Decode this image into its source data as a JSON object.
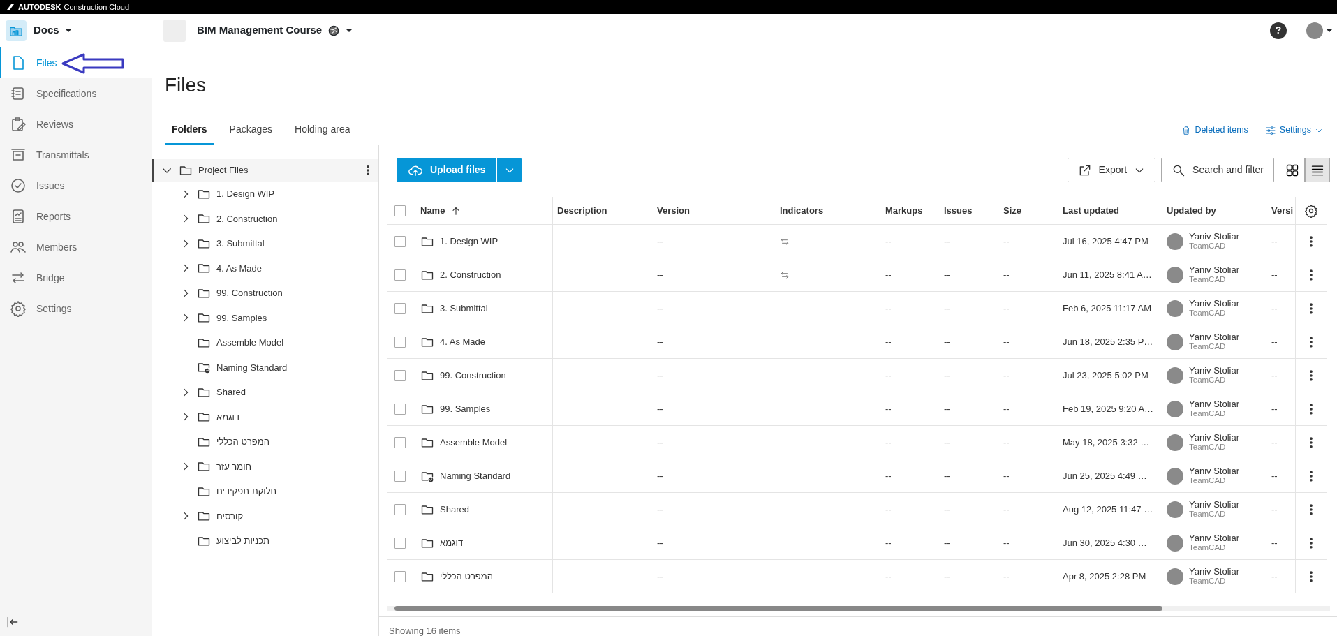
{
  "brand": {
    "name": "AUTODESK",
    "product": "Construction Cloud"
  },
  "header": {
    "module": "Docs",
    "project": "BIM Management Course",
    "help": "?"
  },
  "sidebar": {
    "items": [
      {
        "label": "Files",
        "selected": true
      },
      {
        "label": "Specifications",
        "selected": false
      },
      {
        "label": "Reviews",
        "selected": false
      },
      {
        "label": "Transmittals",
        "selected": false
      },
      {
        "label": "Issues",
        "selected": false
      },
      {
        "label": "Reports",
        "selected": false
      },
      {
        "label": "Members",
        "selected": false
      },
      {
        "label": "Bridge",
        "selected": false
      },
      {
        "label": "Settings",
        "selected": false
      }
    ]
  },
  "page": {
    "title": "Files"
  },
  "tabs": [
    {
      "label": "Folders",
      "selected": true
    },
    {
      "label": "Packages",
      "selected": false
    },
    {
      "label": "Holding area",
      "selected": false
    }
  ],
  "links": {
    "deleted": "Deleted items",
    "settings": "Settings"
  },
  "tree": {
    "label": "Project Files",
    "expanded": true,
    "selected": true,
    "children": [
      {
        "label": "1. Design WIP",
        "kind": "folder",
        "expandable": true
      },
      {
        "label": "2. Construction",
        "kind": "folder",
        "expandable": true
      },
      {
        "label": "3. Submittal",
        "kind": "folder",
        "expandable": true
      },
      {
        "label": "4. As Made",
        "kind": "folder",
        "expandable": true
      },
      {
        "label": "99. Construction",
        "kind": "folder",
        "expandable": true
      },
      {
        "label": "99. Samples",
        "kind": "folder",
        "expandable": true
      },
      {
        "label": "Assemble Model",
        "kind": "folder",
        "expandable": false
      },
      {
        "label": "Naming Standard",
        "kind": "standard",
        "expandable": false
      },
      {
        "label": "Shared",
        "kind": "folder",
        "expandable": true
      },
      {
        "label": "דוגמא",
        "kind": "folder",
        "expandable": true
      },
      {
        "label": "המפרט הכללי",
        "kind": "folder",
        "expandable": false
      },
      {
        "label": "חומר עזר",
        "kind": "folder",
        "expandable": true
      },
      {
        "label": "חלוקת תפקידים",
        "kind": "folder",
        "expandable": false
      },
      {
        "label": "קורסים",
        "kind": "folder",
        "expandable": true
      },
      {
        "label": "תכניות לביצוע",
        "kind": "folder",
        "expandable": false
      }
    ]
  },
  "toolbar": {
    "upload": "Upload files",
    "export": "Export",
    "search": "Search and filter",
    "views": [
      {
        "kind": "grid",
        "selected": false
      },
      {
        "kind": "list",
        "selected": true
      }
    ]
  },
  "table": {
    "all_checked": false,
    "columns": [
      {
        "label": "Name",
        "sorted": true
      },
      {
        "label": "Description",
        "sorted": false
      },
      {
        "label": "Version",
        "sorted": false
      },
      {
        "label": "Indicators",
        "sorted": false
      },
      {
        "label": "Markups",
        "sorted": false
      },
      {
        "label": "Issues",
        "sorted": false
      },
      {
        "label": "Size",
        "sorted": false
      },
      {
        "label": "Last updated",
        "sorted": false
      },
      {
        "label": "Updated by",
        "sorted": false
      },
      {
        "label": "Versi",
        "sorted": false
      }
    ],
    "rows": [
      {
        "name": "1. Design WIP",
        "kind": "folder",
        "checked": false,
        "version": "--",
        "synced": true,
        "markups": "--",
        "issues": "--",
        "size": "--",
        "last_updated": "Jul 16, 2025 4:47 PM",
        "user": "Yaniv Stoliar",
        "company": "TeamCAD",
        "column_10": "--"
      },
      {
        "name": "2. Construction",
        "kind": "folder",
        "checked": false,
        "version": "--",
        "synced": true,
        "markups": "--",
        "issues": "--",
        "size": "--",
        "last_updated": "Jun 11, 2025 8:41 A…",
        "user": "Yaniv Stoliar",
        "company": "TeamCAD",
        "column_10": "--"
      },
      {
        "name": "3. Submittal",
        "kind": "folder",
        "checked": false,
        "version": "--",
        "synced": false,
        "markups": "--",
        "issues": "--",
        "size": "--",
        "last_updated": "Feb 6, 2025 11:17 AM",
        "user": "Yaniv Stoliar",
        "company": "TeamCAD",
        "column_10": "--"
      },
      {
        "name": "4. As Made",
        "kind": "folder",
        "checked": false,
        "version": "--",
        "synced": false,
        "markups": "--",
        "issues": "--",
        "size": "--",
        "last_updated": "Jun 18, 2025 2:35 P…",
        "user": "Yaniv Stoliar",
        "company": "TeamCAD",
        "column_10": "--"
      },
      {
        "name": "99. Construction",
        "kind": "folder",
        "checked": false,
        "version": "--",
        "synced": false,
        "markups": "--",
        "issues": "--",
        "size": "--",
        "last_updated": "Jul 23, 2025 5:02 PM",
        "user": "Yaniv Stoliar",
        "company": "TeamCAD",
        "column_10": "--"
      },
      {
        "name": "99. Samples",
        "kind": "folder",
        "checked": false,
        "version": "--",
        "synced": false,
        "markups": "--",
        "issues": "--",
        "size": "--",
        "last_updated": "Feb 19, 2025 9:20 A…",
        "user": "Yaniv Stoliar",
        "company": "TeamCAD",
        "column_10": "--"
      },
      {
        "name": "Assemble Model",
        "kind": "folder",
        "checked": false,
        "version": "--",
        "synced": false,
        "markups": "--",
        "issues": "--",
        "size": "--",
        "last_updated": "May 18, 2025 3:32 …",
        "user": "Yaniv Stoliar",
        "company": "TeamCAD",
        "column_10": "--"
      },
      {
        "name": "Naming Standard",
        "kind": "standard",
        "checked": false,
        "version": "--",
        "synced": false,
        "markups": "--",
        "issues": "--",
        "size": "--",
        "last_updated": "Jun 25, 2025 4:49 …",
        "user": "Yaniv Stoliar",
        "company": "TeamCAD",
        "column_10": "--"
      },
      {
        "name": "Shared",
        "kind": "folder",
        "checked": false,
        "version": "--",
        "synced": false,
        "markups": "--",
        "issues": "--",
        "size": "--",
        "last_updated": "Aug 12, 2025 11:47 …",
        "user": "Yaniv Stoliar",
        "company": "TeamCAD",
        "column_10": "--"
      },
      {
        "name": "דוגמא",
        "kind": "folder",
        "checked": false,
        "version": "--",
        "synced": false,
        "markups": "--",
        "issues": "--",
        "size": "--",
        "last_updated": "Jun 30, 2025 4:30 …",
        "user": "Yaniv Stoliar",
        "company": "TeamCAD",
        "column_10": "--"
      },
      {
        "name": "המפרט הכללי",
        "kind": "folder",
        "checked": false,
        "version": "--",
        "synced": false,
        "markups": "--",
        "issues": "--",
        "size": "--",
        "last_updated": "Apr 8, 2025 2:28 PM",
        "user": "Yaniv Stoliar",
        "company": "TeamCAD",
        "column_10": "--"
      }
    ]
  },
  "footer": {
    "count": "Showing 16 items"
  }
}
